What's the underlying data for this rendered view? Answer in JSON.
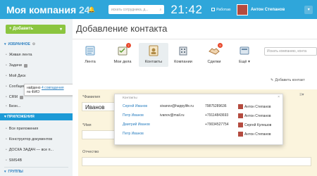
{
  "header": {
    "brand": "Моя компания",
    "brand_num": "24",
    "search_placeholder": "искать сотрудника, д...",
    "clock": "21:42",
    "work_status": "Работаю",
    "user_name": "Антон Степанов"
  },
  "sidebar": {
    "add_button": "+ Добавить",
    "favorites_title": "ИЗБРАННОЕ",
    "favorites": [
      "Живая лента",
      "Задачи",
      "Мой Диск",
      "Сообщения",
      "CRM",
      "Бизн..."
    ],
    "apps_title": "ПРИЛОЖЕНИЯ",
    "apps": [
      "Все приложения",
      "Конструктор документов",
      "ДОСКА ЗАДАЧ — все п...",
      "SMS4B"
    ],
    "groups_title": "ГРУППЫ",
    "tooltip_prefix": "найдено",
    "tooltip_link": "4 совпадения",
    "tooltip_suffix": "по ФИО"
  },
  "main": {
    "title": "Добавление контакта",
    "nav": [
      {
        "label": "Лента",
        "icon": "feed-icon"
      },
      {
        "label": "Мои дела",
        "icon": "tasks-icon",
        "badge": "7"
      },
      {
        "label": "Контакты",
        "icon": "contacts-icon",
        "active": true
      },
      {
        "label": "Компании",
        "icon": "company-icon"
      },
      {
        "label": "Сделки",
        "icon": "deals-icon",
        "badge": "9"
      },
      {
        "label": "Ещё ▾",
        "icon": "more-icon"
      }
    ],
    "search_placeholder": "Искать компанию, конта",
    "add_contact": "Добавить контакт",
    "form": {
      "lastname_label": "*Фамилия",
      "lastname_value": "Иванов",
      "firstname_label": "*Имя",
      "middlename_label": "Отчество"
    }
  },
  "popup": {
    "header": "Контакты",
    "rows": [
      {
        "name": "Сергей Иванов",
        "email": "sivanov@happylife.ru",
        "phone": "79875289636",
        "owner": "Антон Степанов"
      },
      {
        "name": "Петр Иванов",
        "email": "ivanov@mail.ru",
        "phone": "+79114843693",
        "owner": "Антон Степанов"
      },
      {
        "name": "Дмитрий Иванов",
        "email": "",
        "phone": "+79034527754",
        "owner": "Сергей Кулешов"
      },
      {
        "name": "Петр Иванов",
        "email": "",
        "phone": "",
        "owner": "Антон Степанов"
      }
    ]
  },
  "colors": {
    "header_bg": "#2fa6da",
    "add_btn": "#8bc53f",
    "apps_bar": "#1c9ad6",
    "form_bg": "#fbf4dd"
  }
}
